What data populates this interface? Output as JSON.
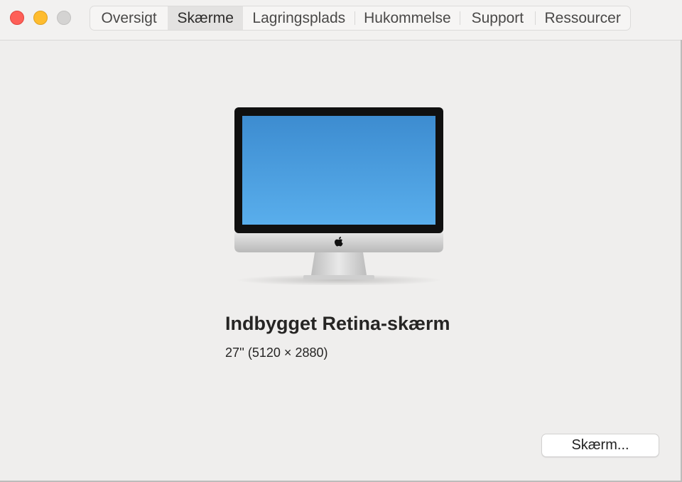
{
  "window": {
    "traffic_lights": {
      "close": "#fe5f57",
      "minimize": "#febc2e",
      "zoom": "#d4d3d2"
    },
    "tabs": [
      {
        "label": "Oversigt",
        "selected": false
      },
      {
        "label": "Skærme",
        "selected": true
      },
      {
        "label": "Lagringsplads",
        "selected": false
      },
      {
        "label": "Hukommelse",
        "selected": false
      },
      {
        "label": "Support",
        "selected": false
      },
      {
        "label": "Ressourcer",
        "selected": false
      }
    ]
  },
  "display": {
    "image_icon": "imac-icon",
    "screen_color": "#4a9de0",
    "name": "Indbygget Retina-skærm",
    "spec": "27'' (5120 × 2880)",
    "button_label": "Skærm..."
  }
}
